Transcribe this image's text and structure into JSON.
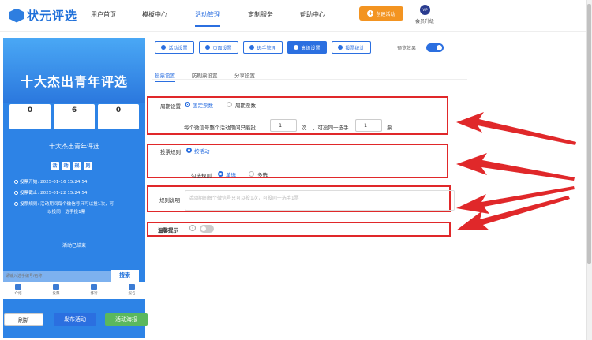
{
  "nav": {
    "logo": "状元评选",
    "items": [
      "用户首页",
      "模板中心",
      "活动管理",
      "定制服务",
      "帮助中心"
    ],
    "create": "创建活动",
    "vip_badge": "VIP",
    "vip_label": "会员升级"
  },
  "preview": {
    "title": "十大杰出青年评选",
    "stats": [
      {
        "num": "0",
        "label": "总票数"
      },
      {
        "num": "6",
        "label": "选手数"
      },
      {
        "num": "0",
        "label": "访问量"
      }
    ],
    "section_title": "十大杰出青年评选",
    "rules_badges": [
      "活",
      "动",
      "规",
      "则"
    ],
    "rules": [
      "投票开始: 2025-01-16 15:24:54",
      "投票截止: 2025-01-22 15:24:54",
      "投票规则: 活动期间每个微信号只可以投1次，可",
      "以投同一选手投1票"
    ],
    "ended": "活动已结束",
    "search_placeholder": "请输入选手编号/名称",
    "search_btn": "搜索",
    "tabs": [
      "介绍",
      "投票",
      "排行",
      "报名"
    ],
    "refresh": "刷新",
    "publish": "发布活动",
    "poster": "活动海报"
  },
  "toolbar": {
    "buttons": [
      "活动设置",
      "页面设置",
      "选手管理",
      "高级设置",
      "投票统计"
    ],
    "preview_label": "预览效果"
  },
  "subtabs": [
    "投票设置",
    "防刷票设置",
    "分享设置"
  ],
  "form": {
    "period_label": "周期设置",
    "fixed": "固定票数",
    "cycle": "周期票数",
    "desc_prefix": "每个微信号整个活动期间只能投",
    "times": "次",
    "desc_mid": "，可投同一选手",
    "vote_unit": "票",
    "num1": "1",
    "num2": "1",
    "rule_label": "投票规则",
    "rule_opt": "按活动",
    "check_label": "勾选规则",
    "single": "单选",
    "multi": "多选",
    "desc_label": "规则说明",
    "desc_placeholder": "活动期间每个微信号只可以投1次，可投同一选手1票",
    "tip_label": "温馨提示",
    "help": "?"
  },
  "colors": {
    "accent": "#2b6fe0",
    "highlight": "#e0282a",
    "orange": "#f39421"
  }
}
